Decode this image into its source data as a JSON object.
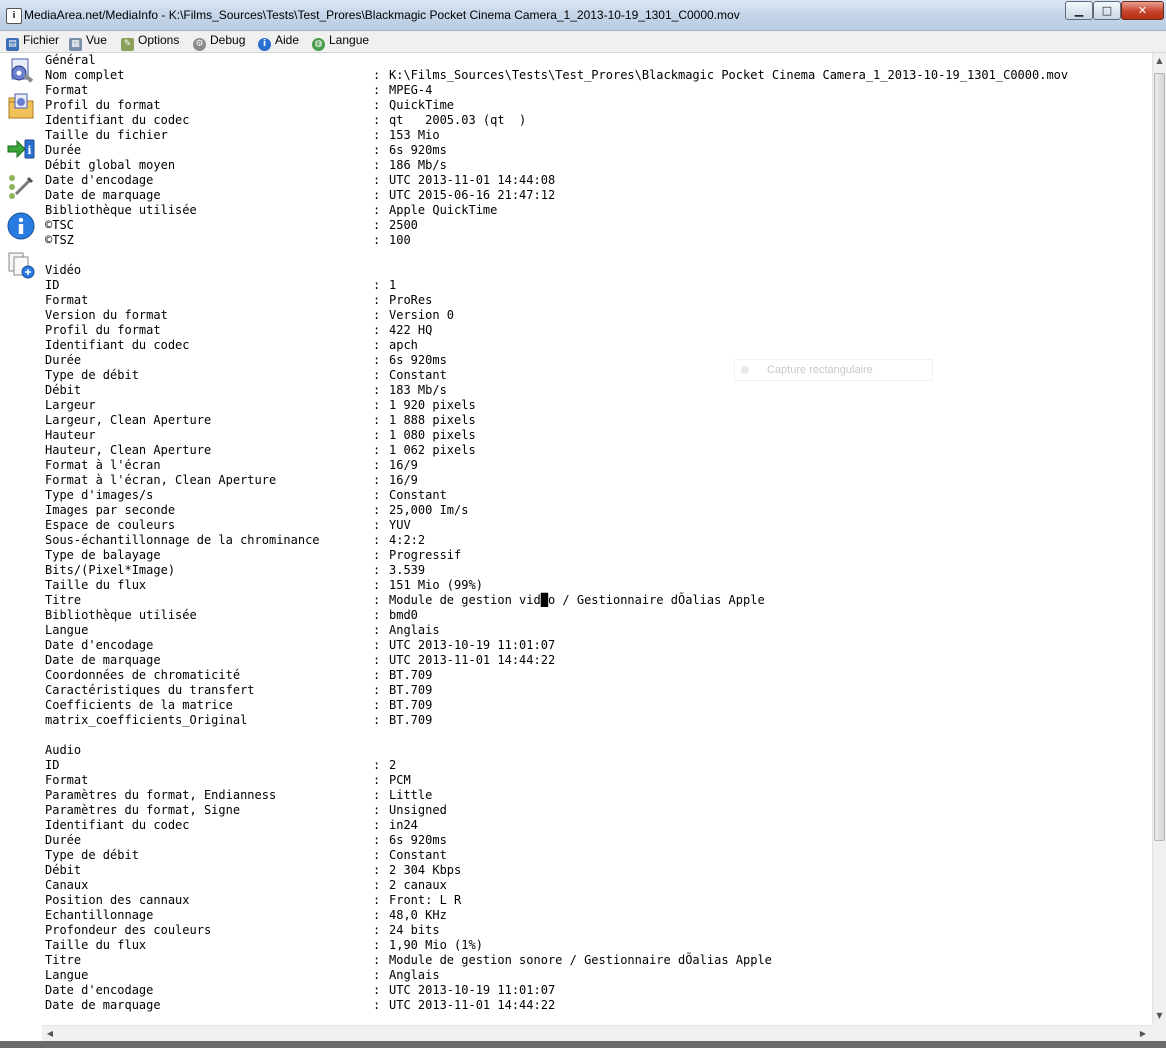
{
  "window": {
    "title": "MediaArea.net/MediaInfo - K:\\Films_Sources\\Tests\\Test_Prores\\Blackmagic Pocket Cinema Camera_1_2013-10-19_1301_C0000.mov",
    "min_glyph": "▁",
    "max_glyph": "□",
    "close_glyph": "✕"
  },
  "menu": [
    {
      "label": "Fichier",
      "icon": "file-icon"
    },
    {
      "label": "Vue",
      "icon": "view-icon"
    },
    {
      "label": "Options",
      "icon": "options-icon"
    },
    {
      "label": "Debug",
      "icon": "debug-icon"
    },
    {
      "label": "Aide",
      "icon": "help-icon"
    },
    {
      "label": "Langue",
      "icon": "language-icon"
    }
  ],
  "toolbar": [
    {
      "name": "open-file-icon"
    },
    {
      "name": "open-folder-icon"
    },
    {
      "name": "export-icon"
    },
    {
      "name": "preferences-icon"
    },
    {
      "name": "about-icon"
    },
    {
      "name": "sheet-view-icon"
    }
  ],
  "overlay_label": "Capture rectangulaire",
  "sections": [
    {
      "title": "Général",
      "rows": [
        [
          "Nom complet",
          "K:\\Films_Sources\\Tests\\Test_Prores\\Blackmagic Pocket Cinema Camera_1_2013-10-19_1301_C0000.mov"
        ],
        [
          "Format",
          "MPEG-4"
        ],
        [
          "Profil du format",
          "QuickTime"
        ],
        [
          "Identifiant du codec",
          "qt   2005.03 (qt  )"
        ],
        [
          "Taille du fichier",
          "153 Mio"
        ],
        [
          "Durée",
          "6s 920ms"
        ],
        [
          "Débit global moyen",
          "186 Mb/s"
        ],
        [
          "Date d'encodage",
          "UTC 2013-11-01 14:44:08"
        ],
        [
          "Date de marquage",
          "UTC 2015-06-16 21:47:12"
        ],
        [
          "Bibliothèque utilisée",
          "Apple QuickTime"
        ],
        [
          "©TSC",
          "2500"
        ],
        [
          "©TSZ",
          "100"
        ]
      ]
    },
    {
      "title": "Vidéo",
      "rows": [
        [
          "ID",
          "1"
        ],
        [
          "Format",
          "ProRes"
        ],
        [
          "Version du format",
          "Version 0"
        ],
        [
          "Profil du format",
          "422 HQ"
        ],
        [
          "Identifiant du codec",
          "apch"
        ],
        [
          "Durée",
          "6s 920ms"
        ],
        [
          "Type de débit",
          "Constant"
        ],
        [
          "Débit",
          "183 Mb/s"
        ],
        [
          "Largeur",
          "1 920 pixels"
        ],
        [
          "Largeur, Clean Aperture",
          "1 888 pixels"
        ],
        [
          "Hauteur",
          "1 080 pixels"
        ],
        [
          "Hauteur, Clean Aperture",
          "1 062 pixels"
        ],
        [
          "Format à l'écran",
          "16/9"
        ],
        [
          "Format à l'écran, Clean Aperture",
          "16/9"
        ],
        [
          "Type d'images/s",
          "Constant"
        ],
        [
          "Images par seconde",
          "25,000 Im/s"
        ],
        [
          "Espace de couleurs",
          "YUV"
        ],
        [
          "Sous-échantillonnage de la chrominance",
          "4:2:2"
        ],
        [
          "Type de balayage",
          "Progressif"
        ],
        [
          "Bits/(Pixel*Image)",
          "3.539"
        ],
        [
          "Taille du flux",
          "151 Mio (99%)"
        ],
        [
          "Titre",
          "Module de gestion vid█o / Gestionnaire dÕalias Apple"
        ],
        [
          "Bibliothèque utilisée",
          "bmd0"
        ],
        [
          "Langue",
          "Anglais"
        ],
        [
          "Date d'encodage",
          "UTC 2013-10-19 11:01:07"
        ],
        [
          "Date de marquage",
          "UTC 2013-11-01 14:44:22"
        ],
        [
          "Coordonnées de chromaticité",
          "BT.709"
        ],
        [
          "Caractéristiques du transfert",
          "BT.709"
        ],
        [
          "Coefficients de la matrice",
          "BT.709"
        ],
        [
          "matrix_coefficients_Original",
          "BT.709"
        ]
      ]
    },
    {
      "title": "Audio",
      "rows": [
        [
          "ID",
          "2"
        ],
        [
          "Format",
          "PCM"
        ],
        [
          "Paramètres du format, Endianness",
          "Little"
        ],
        [
          "Paramètres du format, Signe",
          "Unsigned"
        ],
        [
          "Identifiant du codec",
          "in24"
        ],
        [
          "Durée",
          "6s 920ms"
        ],
        [
          "Type de débit",
          "Constant"
        ],
        [
          "Débit",
          "2 304 Kbps"
        ],
        [
          "Canaux",
          "2 canaux"
        ],
        [
          "Position des cannaux",
          "Front: L R"
        ],
        [
          "Echantillonnage",
          "48,0 KHz"
        ],
        [
          "Profondeur des couleurs",
          "24 bits"
        ],
        [
          "Taille du flux",
          "1,90 Mio (1%)"
        ],
        [
          "Titre",
          "Module de gestion sonore / Gestionnaire dÕalias Apple"
        ],
        [
          "Langue",
          "Anglais"
        ],
        [
          "Date d'encodage",
          "UTC 2013-10-19 11:01:07"
        ],
        [
          "Date de marquage",
          "UTC 2013-11-01 14:44:22"
        ]
      ]
    }
  ]
}
